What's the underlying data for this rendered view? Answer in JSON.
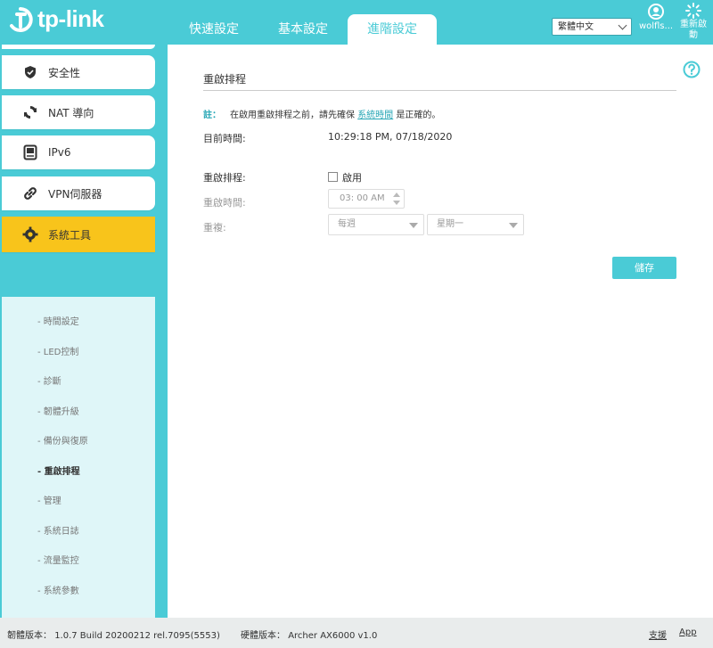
{
  "brand": {
    "logo_text": "tp-link"
  },
  "header": {
    "tabs": [
      {
        "label": "快速設定"
      },
      {
        "label": "基本設定"
      },
      {
        "label": "進階設定"
      }
    ],
    "language": "繁體中文",
    "user_label": "wolfls...",
    "reboot_label": "重新啟動"
  },
  "sidebar": {
    "items": [
      {
        "label": "安全性",
        "icon": "shield-icon"
      },
      {
        "label": "NAT 導向",
        "icon": "nat-icon"
      },
      {
        "label": "IPv6",
        "icon": "ipv6-icon"
      },
      {
        "label": "VPN伺服器",
        "icon": "vpn-icon"
      },
      {
        "label": "系統工具",
        "icon": "gear-icon"
      }
    ],
    "submenu": [
      {
        "label": "- 時間設定"
      },
      {
        "label": "- LED控制"
      },
      {
        "label": "- 診斷"
      },
      {
        "label": "- 韌體升級"
      },
      {
        "label": "- 備份與復原"
      },
      {
        "label": "- 重啟排程"
      },
      {
        "label": "- 管理"
      },
      {
        "label": "- 系統日誌"
      },
      {
        "label": "- 流量監控"
      },
      {
        "label": "- 系統參數"
      }
    ]
  },
  "main": {
    "title": "重啟排程",
    "note_label": "註：",
    "note_before": "在啟用重啟排程之前，請先確保",
    "note_link": "系統時間",
    "note_after": "是正確的。",
    "current_time_label": "目前時間:",
    "current_time_value": "10:29:18 PM, 07/18/2020",
    "schedule_label": "重啟排程:",
    "enable_label": "啟用",
    "reboot_time_label": "重啟時間:",
    "reboot_time_value": "03: 00 AM",
    "repeat_label": "重複:",
    "repeat_value": "每週",
    "weekday_value": "星期一",
    "save_label": "儲存"
  },
  "footer": {
    "firmware_label": "韌體版本：",
    "firmware_value": "1.0.7 Build 20200212 rel.7095(5553)",
    "hardware_label": "硬體版本：",
    "hardware_value": "Archer AX6000 v1.0",
    "support_label": "支援",
    "app_label": "App"
  },
  "colors": {
    "brand_teal": "#4acbd6",
    "active_yellow": "#f8c41b",
    "submenu_bg": "#dff6f8",
    "link": "#26a6b5"
  }
}
